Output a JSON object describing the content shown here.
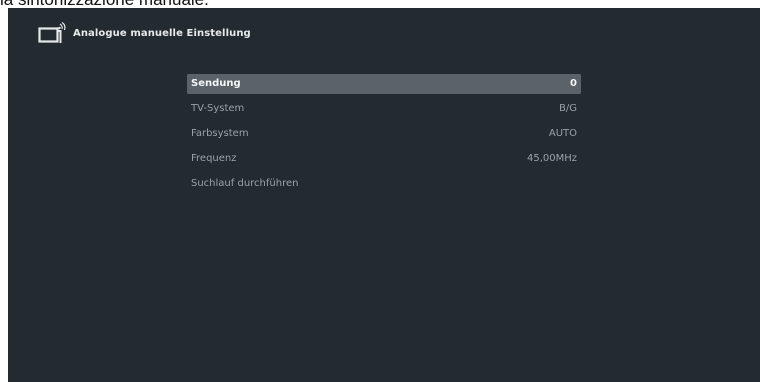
{
  "caption": "la sintonizzazione manuale.",
  "header": {
    "icon": "tv-antenna-icon",
    "title": "Analogue manuelle Einstellung"
  },
  "menu": {
    "items": [
      {
        "label": "Sendung",
        "value": "0",
        "selected": true
      },
      {
        "label": "TV-System",
        "value": "B/G",
        "selected": false
      },
      {
        "label": "Farbsystem",
        "value": "AUTO",
        "selected": false
      },
      {
        "label": "Frequenz",
        "value": "45,00MHz",
        "selected": false
      },
      {
        "label": "Suchlauf durchführen",
        "value": "",
        "selected": false
      }
    ]
  },
  "colors": {
    "background": "#232b30",
    "selected_row": "#5b6368",
    "text_dim": "#9aa2a6",
    "text_bright": "#f3f5f6"
  }
}
